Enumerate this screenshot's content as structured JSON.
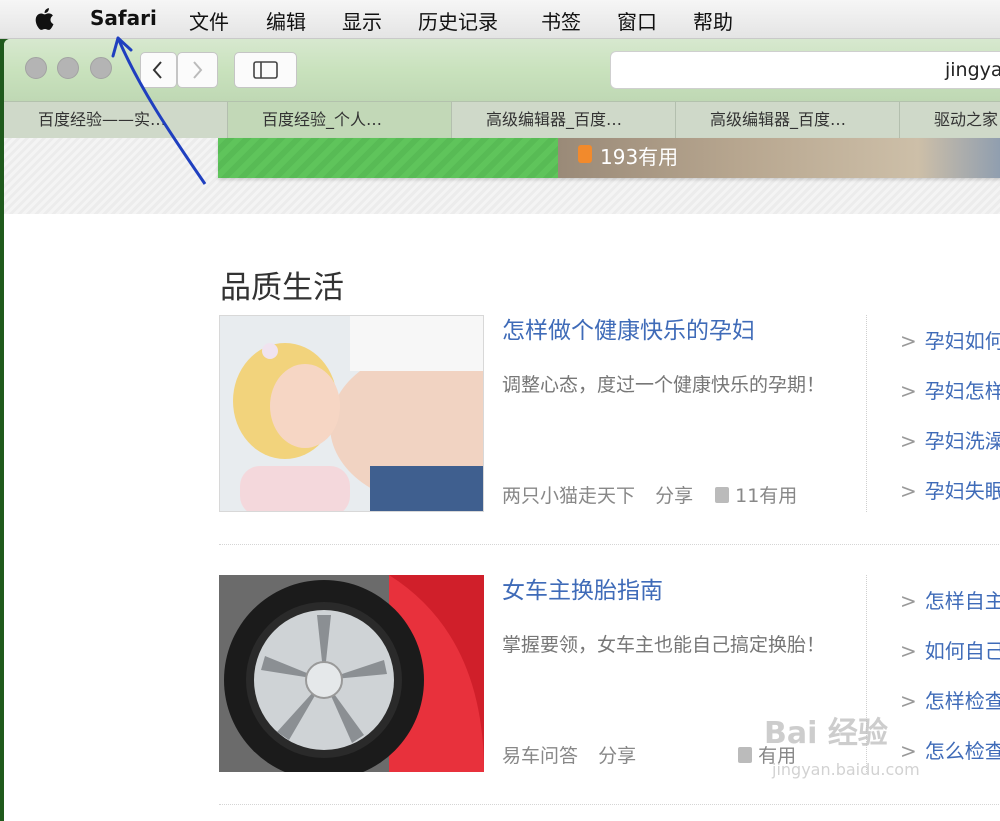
{
  "menubar": {
    "app_name": "Safari",
    "items": [
      "文件",
      "编辑",
      "显示",
      "历史记录",
      "书签",
      "窗口",
      "帮助"
    ]
  },
  "browser": {
    "address_text": "jingya",
    "tabs": [
      "百度经验——实…",
      "百度经验_个人…",
      "高级编辑器_百度…",
      "高级编辑器_百度…",
      "驱动之家"
    ],
    "active_tab": 1
  },
  "hero": {
    "count_text": "193有用"
  },
  "section": {
    "title": "品质生活"
  },
  "cards": [
    {
      "title": "怎样做个健康快乐的孕妇",
      "desc": "调整心态，度过一个健康快乐的孕期！",
      "author": "两只小猫走天下",
      "share": "分享",
      "useful": "11有用",
      "links": [
        "孕妇如何",
        "孕妇怎样",
        "孕妇洗澡",
        "孕妇失眠"
      ]
    },
    {
      "title": "女车主换胎指南",
      "desc": "掌握要领，女车主也能自己搞定换胎！",
      "author": "易车问答",
      "share": "分享",
      "useful": "有用",
      "links": [
        "怎样自主",
        "如何自己",
        "怎样检查",
        "怎么检查"
      ]
    }
  ],
  "watermark": {
    "brand": "Bai 经验",
    "url": "jingyan.baidu.com"
  },
  "colors": {
    "link": "#3f6bb8",
    "accent_green": "#5fc45b",
    "annotation_arrow": "#1f3fbf"
  }
}
